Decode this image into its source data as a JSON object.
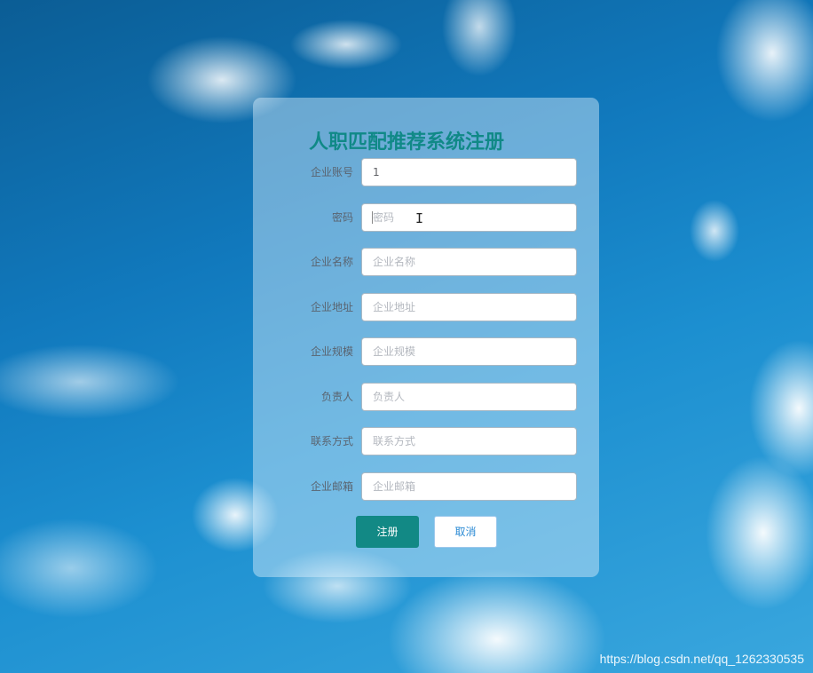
{
  "form": {
    "title": "人职匹配推荐系统注册",
    "fields": [
      {
        "label": "企业账号",
        "value": "1",
        "placeholder": ""
      },
      {
        "label": "密码",
        "value": "",
        "placeholder": "密码"
      },
      {
        "label": "企业名称",
        "value": "",
        "placeholder": "企业名称"
      },
      {
        "label": "企业地址",
        "value": "",
        "placeholder": "企业地址"
      },
      {
        "label": "企业规模",
        "value": "",
        "placeholder": "企业规模"
      },
      {
        "label": "负责人",
        "value": "",
        "placeholder": "负责人"
      },
      {
        "label": "联系方式",
        "value": "",
        "placeholder": "联系方式"
      },
      {
        "label": "企业邮箱",
        "value": "",
        "placeholder": "企业邮箱"
      }
    ],
    "register_label": "注册",
    "cancel_label": "取消"
  },
  "watermark": "https://blog.csdn.net/qq_1262330535",
  "colors": {
    "accent": "#128985",
    "title": "#108987",
    "cancel_text": "#2a8ad4"
  }
}
